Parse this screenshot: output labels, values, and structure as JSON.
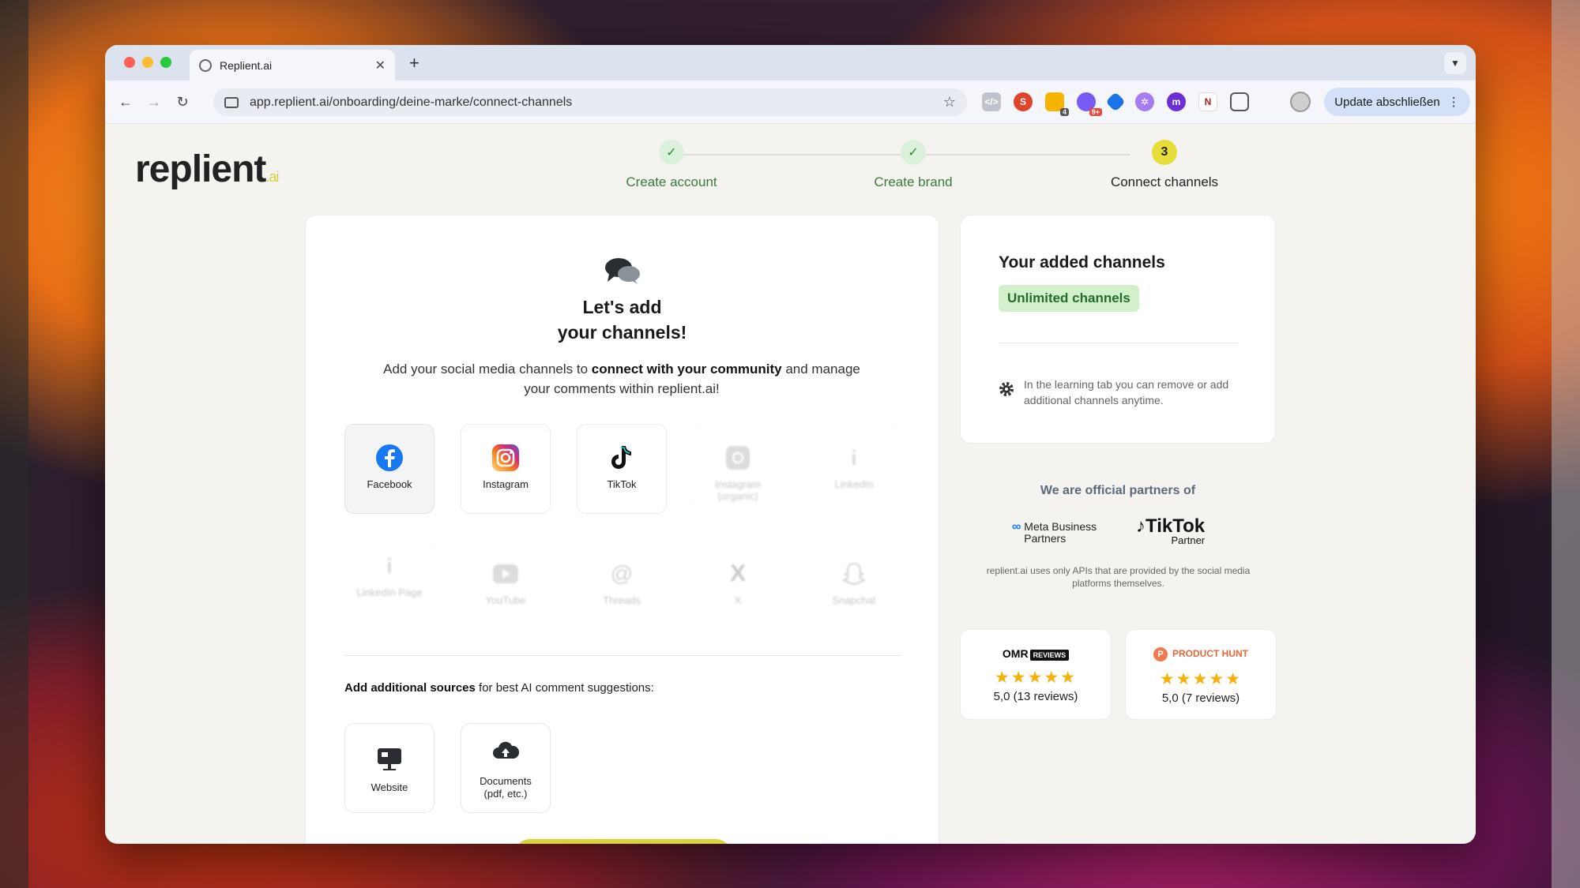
{
  "browser": {
    "tab_title": "Replient.ai",
    "new_tab": "+",
    "url": "app.replient.ai/onboarding/deine-marke/connect-channels",
    "update_label": "Update abschließen",
    "extension_badges": [
      "4",
      "9+"
    ]
  },
  "logo": {
    "name": "replient",
    "suffix": ".ai"
  },
  "steps": [
    {
      "label": "Create account",
      "state": "done"
    },
    {
      "label": "Create brand",
      "state": "done"
    },
    {
      "label": "Connect channels",
      "state": "current",
      "number": "3"
    }
  ],
  "main": {
    "title_line1": "Let's add",
    "title_line2": "your channels!",
    "desc_pre": "Add your social media channels to ",
    "desc_bold": "connect with your community",
    "desc_post": " and manage your comments within replient.ai!",
    "channels": [
      {
        "label": "Facebook",
        "icon": "facebook-icon",
        "state": "active"
      },
      {
        "label": "Instagram",
        "icon": "instagram-icon",
        "state": "enabled"
      },
      {
        "label": "TikTok",
        "icon": "tiktok-icon",
        "state": "enabled"
      },
      {
        "label": "Instagram (organic)",
        "icon": "instagram-organic-icon",
        "state": "faded"
      },
      {
        "label": "LinkedIn",
        "icon": "linkedin-icon",
        "state": "faded"
      },
      {
        "label": "LinkedIn Page",
        "icon": "linkedin-page-icon",
        "state": "faded"
      },
      {
        "label": "YouTube",
        "icon": "youtube-icon",
        "state": "faded"
      },
      {
        "label": "Threads",
        "icon": "threads-icon",
        "state": "faded"
      },
      {
        "label": "X",
        "icon": "x-icon",
        "state": "faded"
      },
      {
        "label": "Snapchat",
        "icon": "snapchat-icon",
        "state": "faded"
      }
    ],
    "sources_bold": "Add additional sources",
    "sources_rest": " for best AI comment suggestions:",
    "sources": [
      {
        "label": "Website",
        "icon": "website-icon"
      },
      {
        "label": "Documents (pdf, etc.)",
        "icon": "cloud-upload-icon"
      }
    ]
  },
  "side": {
    "title": "Your added channels",
    "badge": "Unlimited channels",
    "note": "In the learning tab you can remove or add additional channels anytime.",
    "partners_title": "We are official partners of",
    "meta_partner": "Meta Business Partners",
    "tiktok_partner": "TikTok",
    "tiktok_partner_sub": "Partner",
    "api_note": "replient.ai uses only APIs that are provided by the social media platforms themselves.",
    "reviews": [
      {
        "brand": "OMR",
        "brand_box": "REVIEWS",
        "stars": "★★★★★",
        "text": "5,0 (13 reviews)"
      },
      {
        "brand": "PRODUCT HUNT",
        "stars": "★★★★★",
        "text": "5,0 (7 reviews)"
      }
    ]
  },
  "colors": {
    "accent_yellow": "#e6dd3a",
    "step_done_green": "#3d7a3a",
    "badge_green_bg": "#d2f0cc",
    "star": "#f5b10a"
  }
}
